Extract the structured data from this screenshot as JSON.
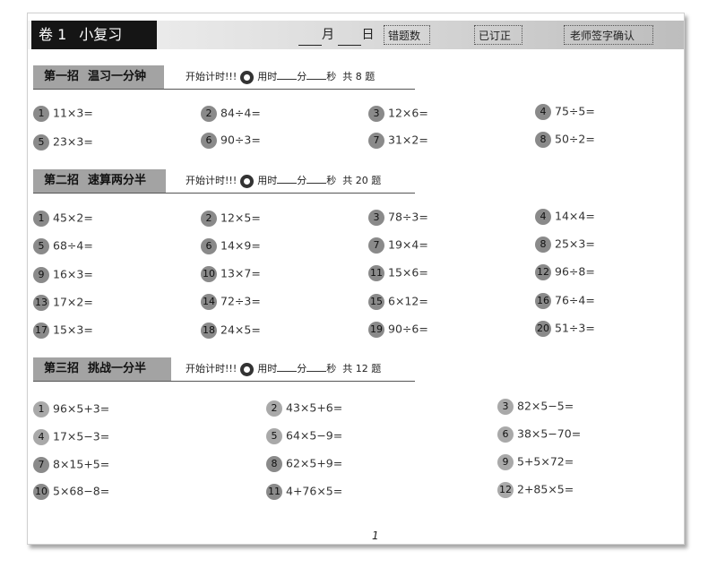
{
  "header": {
    "volume": "卷 1",
    "title": "小复习",
    "month_label": "月",
    "day_label": "日",
    "errors_label": "错题数",
    "corrected_label": "已订正",
    "teacher_label": "老师签字确认"
  },
  "sections": [
    {
      "badge": "第一招",
      "name": "温习一分钟",
      "start": "开始计时!!!",
      "used": "用时",
      "min": "分",
      "sec": "秒",
      "total": "共 8 题",
      "problems": [
        {
          "n": "1",
          "e": "11×3="
        },
        {
          "n": "2",
          "e": "84÷4="
        },
        {
          "n": "3",
          "e": "12×6="
        },
        {
          "n": "4",
          "e": "75÷5="
        },
        {
          "n": "5",
          "e": "23×3="
        },
        {
          "n": "6",
          "e": "90÷3="
        },
        {
          "n": "7",
          "e": "31×2="
        },
        {
          "n": "8",
          "e": "50÷2="
        }
      ]
    },
    {
      "badge": "第二招",
      "name": "速算两分半",
      "start": "开始计时!!!",
      "used": "用时",
      "min": "分",
      "sec": "秒",
      "total": "共 20 题",
      "problems": [
        {
          "n": "1",
          "e": "45×2="
        },
        {
          "n": "2",
          "e": "12×5="
        },
        {
          "n": "3",
          "e": "78÷3="
        },
        {
          "n": "4",
          "e": "14×4="
        },
        {
          "n": "5",
          "e": "68÷4="
        },
        {
          "n": "6",
          "e": "14×9="
        },
        {
          "n": "7",
          "e": "19×4="
        },
        {
          "n": "8",
          "e": "25×3="
        },
        {
          "n": "9",
          "e": "16×3="
        },
        {
          "n": "10",
          "e": "13×7="
        },
        {
          "n": "11",
          "e": "15×6="
        },
        {
          "n": "12",
          "e": "96÷8="
        },
        {
          "n": "13",
          "e": "17×2="
        },
        {
          "n": "14",
          "e": "72÷3="
        },
        {
          "n": "15",
          "e": "6×12="
        },
        {
          "n": "16",
          "e": "76÷4="
        },
        {
          "n": "17",
          "e": "15×3="
        },
        {
          "n": "18",
          "e": "24×5="
        },
        {
          "n": "19",
          "e": "90÷6="
        },
        {
          "n": "20",
          "e": "51÷3="
        }
      ]
    },
    {
      "badge": "第三招",
      "name": "挑战一分半",
      "start": "开始计时!!!",
      "used": "用时",
      "min": "分",
      "sec": "秒",
      "total": "共 12 题",
      "problems": [
        {
          "n": "1",
          "e": "96×5+3="
        },
        {
          "n": "2",
          "e": "43×5+6="
        },
        {
          "n": "3",
          "e": "82×5−5="
        },
        {
          "n": "4",
          "e": "17×5−3="
        },
        {
          "n": "5",
          "e": "64×5−9="
        },
        {
          "n": "6",
          "e": "38×5−70="
        },
        {
          "n": "7",
          "e": "8×15+5="
        },
        {
          "n": "8",
          "e": "62×5+9="
        },
        {
          "n": "9",
          "e": "5+5×72="
        },
        {
          "n": "10",
          "e": "5×68−8="
        },
        {
          "n": "11",
          "e": "4+76×5="
        },
        {
          "n": "12",
          "e": "2+85×5="
        }
      ]
    }
  ],
  "page_number": "1"
}
